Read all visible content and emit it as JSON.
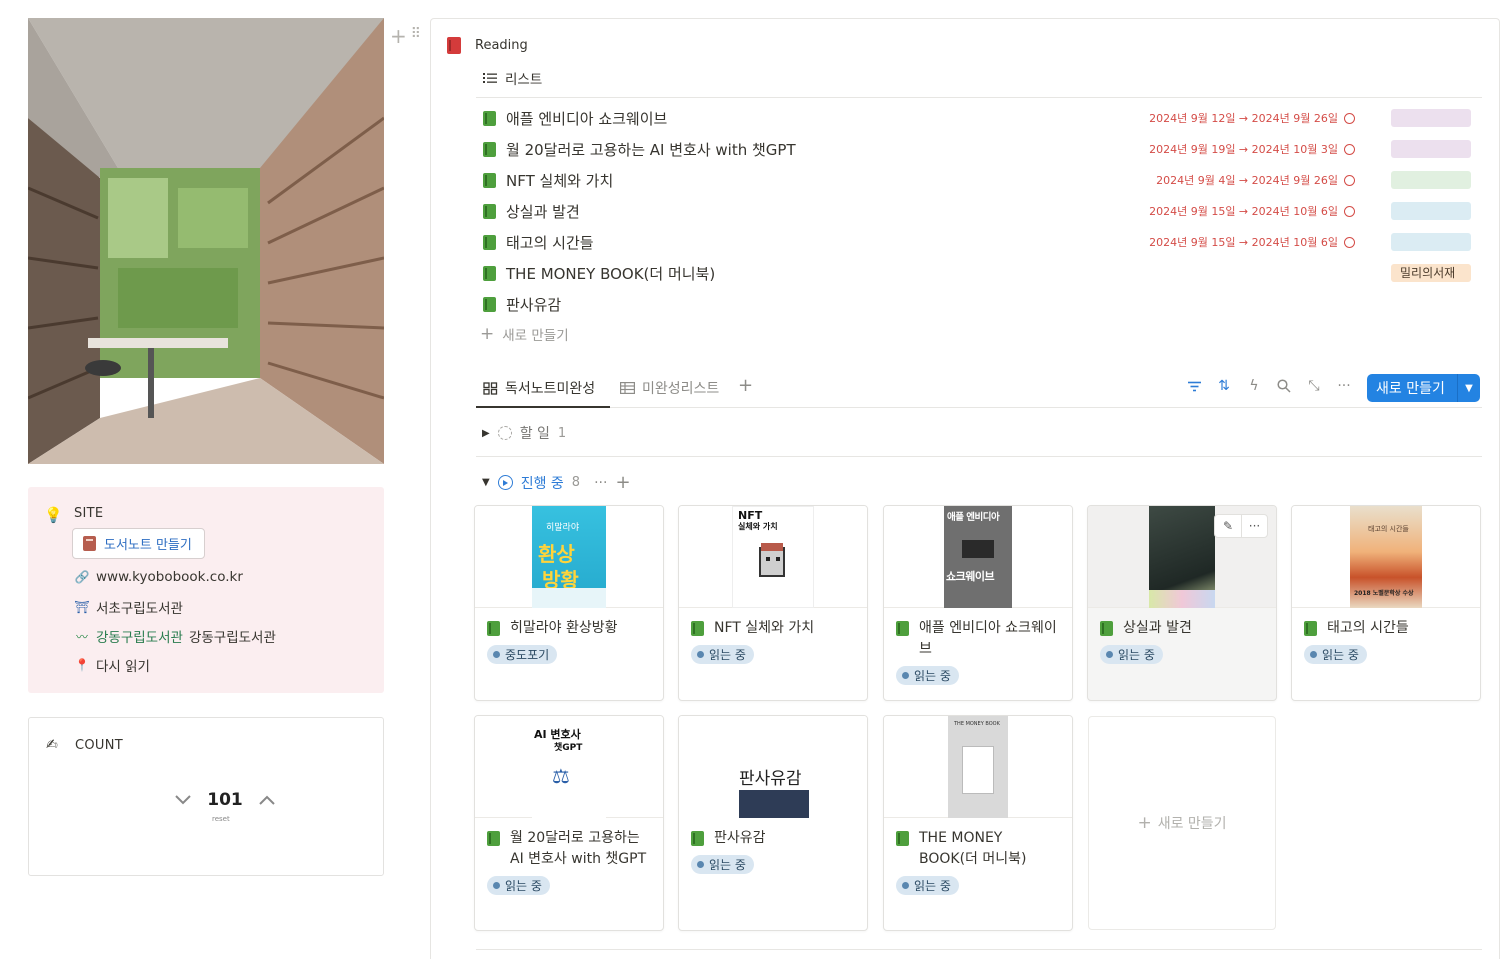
{
  "site": {
    "title": "SITE",
    "button_label": "도서노트 만들기",
    "links": [
      {
        "icon": "link-icon",
        "label": "www.kyobobook.co.kr"
      },
      {
        "icon": "library-icon",
        "label": "서초구립도서관"
      },
      {
        "icon": "library-logo-icon",
        "label_prefix": "강동구립도서관",
        "label": "강동구립도서관"
      },
      {
        "icon": "pin-icon",
        "label": "다시 읽기"
      }
    ]
  },
  "count": {
    "title": "COUNT",
    "value": "101",
    "reset_label": "reset"
  },
  "reading": {
    "title": "Reading",
    "list_tab": "리스트",
    "items": [
      {
        "name": "애플 엔비디아 쇼크웨이브",
        "date": "2024년 9월 12일 → 2024년 9월 26일",
        "tag": "",
        "tag_color": "#ece0ee"
      },
      {
        "name": "월 20달러로 고용하는 AI 변호사 with 챗GPT",
        "date": "2024년 9월 19일 → 2024년 10월 3일",
        "tag": "",
        "tag_color": "#ece0ee"
      },
      {
        "name": "NFT 실체와 가치",
        "date": "2024년 9월 4일 → 2024년 9월 26일",
        "tag": "",
        "tag_color": "#e1f0e0"
      },
      {
        "name": "상실과 발견",
        "date": "2024년 9월 15일 → 2024년 10월 6일",
        "tag": "",
        "tag_color": "#dbecf3"
      },
      {
        "name": "태고의 시간들",
        "date": "2024년 9월 15일 → 2024년 10월 6일",
        "tag": "",
        "tag_color": "#dbecf3"
      },
      {
        "name": "THE MONEY BOOK(더 머니북)",
        "date": "",
        "tag": "밀리의서재",
        "tag_color": "#fbe4cc"
      },
      {
        "name": "판사유감",
        "date": "",
        "tag": "",
        "tag_color": ""
      }
    ],
    "new_label": "새로 만들기"
  },
  "board": {
    "tabs": [
      {
        "label": "독서노트미완성",
        "icon": "board-icon"
      },
      {
        "label": "미완성리스트",
        "icon": "table-icon"
      }
    ],
    "new_button": "새로 만들기",
    "group_todo": {
      "label": "할 일",
      "count": "1"
    },
    "group_progress": {
      "label": "진행 중",
      "count": "8"
    },
    "cards": [
      {
        "title": "히말라야 환상방황",
        "status": "중도포기",
        "cover": "himalaya"
      },
      {
        "title": "NFT 실체와 가치",
        "status": "읽는 중",
        "cover": "nft"
      },
      {
        "title": "애플 엔비디아 쇼크웨이브",
        "status": "읽는 중",
        "cover": "apple"
      },
      {
        "title": "상실과 발견",
        "status": "읽는 중",
        "cover": "loss"
      },
      {
        "title": "태고의 시간들",
        "status": "읽는 중",
        "cover": "primeval"
      },
      {
        "title": "월 20달러로 고용하는 AI 변호사 with 챗GPT",
        "status": "읽는 중",
        "cover": "ai"
      },
      {
        "title": "판사유감",
        "status": "읽는 중",
        "cover": "judge"
      },
      {
        "title": "THE MONEY BOOK(더 머니북)",
        "status": "읽는 중",
        "cover": "money"
      }
    ],
    "new_card_label": "새로 만들기"
  },
  "cover_text": {
    "himalaya_1": "히말라야",
    "himalaya_2": "환상",
    "himalaya_3": "방황",
    "nft_1": "NFT",
    "nft_2": "실체와 가치",
    "apple_1": "애플 엔비디아",
    "apple_2": "쇼크웨이브",
    "primeval_1": "2018 노벨문학상 수상",
    "primeval_2": "태고의 시간들",
    "ai_1": "AI 변호사",
    "ai_2": "챗GPT",
    "judge_1": "판사유감",
    "money_1": "THE MONEY BOOK"
  }
}
